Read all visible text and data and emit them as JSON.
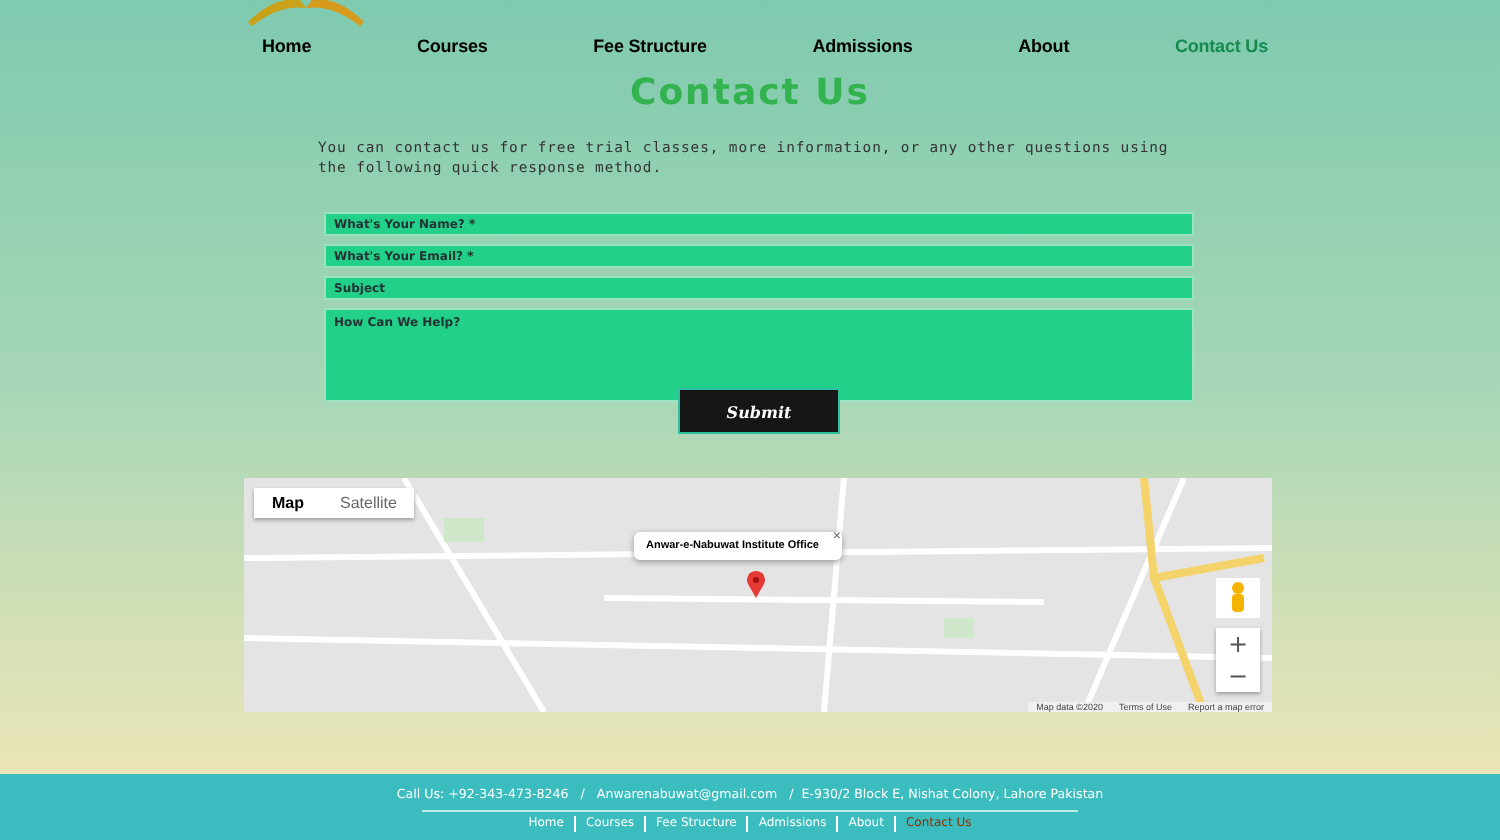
{
  "nav": [
    {
      "label": "Home",
      "selected": false
    },
    {
      "label": "Courses",
      "selected": false
    },
    {
      "label": "Fee Structure",
      "selected": false
    },
    {
      "label": "Admissions",
      "selected": false
    },
    {
      "label": "About",
      "selected": false
    },
    {
      "label": "Contact Us",
      "selected": true
    }
  ],
  "title": "Contact Us",
  "intro": "You can contact us for free trial classes, more information, or any other questions using the following quick response method.",
  "form": {
    "fields": [
      {
        "kind": "input",
        "placeholder": "What's Your Name? *"
      },
      {
        "kind": "input",
        "placeholder": "What's Your Email? *"
      },
      {
        "kind": "input",
        "placeholder": "Subject"
      },
      {
        "kind": "textarea",
        "placeholder": "How Can We Help?"
      }
    ],
    "submit": "Submit"
  },
  "map": {
    "map_types": [
      {
        "label": "Map",
        "selected": true
      },
      {
        "label": "Satellite",
        "selected": false
      }
    ],
    "info_window": "Anwar-e-Nabuwat Institute Office",
    "close": "×",
    "zoom_in": "+",
    "zoom_out": "−",
    "attribution": [
      "Map data ©2020",
      "Terms of Use",
      "Report a map error"
    ]
  },
  "footer": {
    "contact": "Call Us: +92-343-473-8246   /   Anwarenabuwat@gmail.com   /  E-930/2 Block E, Nishat Colony, Lahore Pakistan",
    "links": [
      {
        "label": "Home",
        "selected": false
      },
      {
        "label": "Courses",
        "selected": false
      },
      {
        "label": "Fee Structure",
        "selected": false
      },
      {
        "label": "Admissions",
        "selected": false
      },
      {
        "label": "About",
        "selected": false
      },
      {
        "label": "Contact Us",
        "selected": true
      }
    ]
  }
}
